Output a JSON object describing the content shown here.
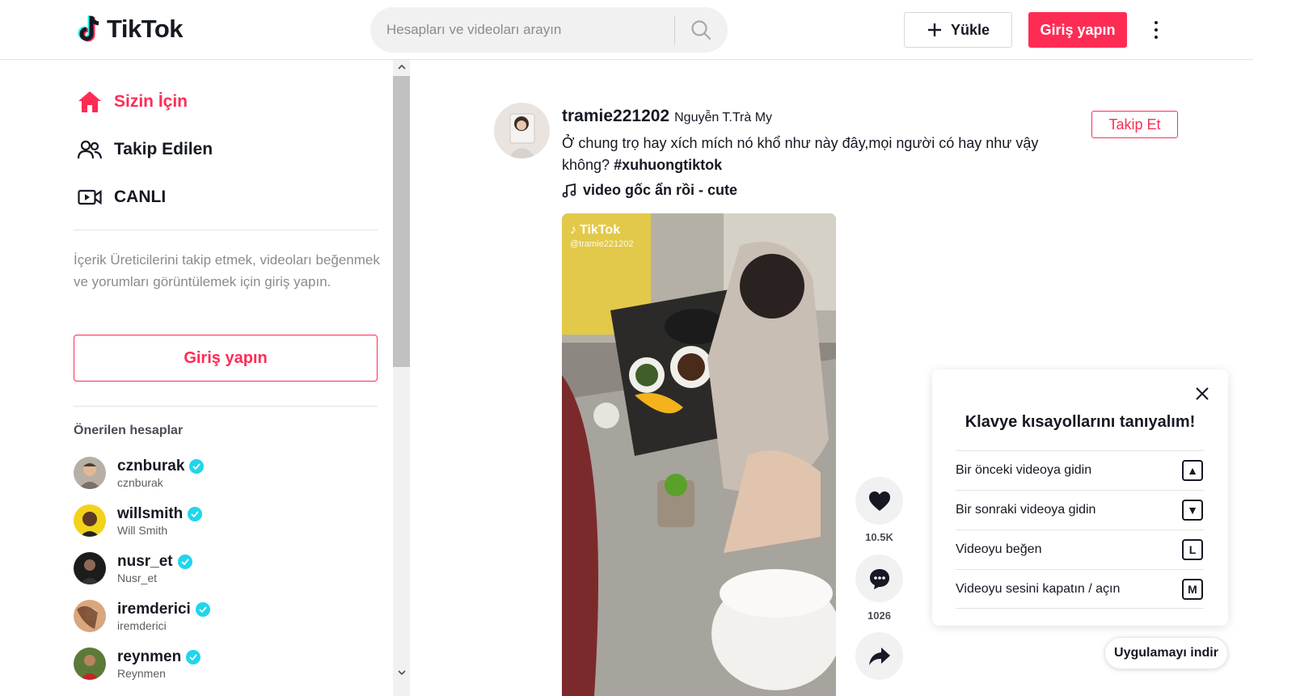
{
  "header": {
    "logo_text": "TikTok",
    "search_placeholder": "Hesapları ve videoları arayın",
    "upload_label": "Yükle",
    "login_label": "Giriş yapın"
  },
  "sidebar": {
    "nav": [
      {
        "label": "Sizin İçin",
        "icon": "home-icon",
        "active": true
      },
      {
        "label": "Takip Edilen",
        "icon": "people-icon",
        "active": false
      },
      {
        "label": "CANLI",
        "icon": "live-icon",
        "active": false
      }
    ],
    "login_prompt": "İçerik Üreticilerini takip etmek, videoları beğenmek ve yorumları görüntülemek için giriş yapın.",
    "login_button": "Giriş yapın",
    "suggested_title": "Önerilen hesaplar",
    "accounts": [
      {
        "username": "cznburak",
        "name": "cznburak",
        "verified": true
      },
      {
        "username": "willsmith",
        "name": "Will Smith",
        "verified": true
      },
      {
        "username": "nusr_et",
        "name": "Nusr_et",
        "verified": true
      },
      {
        "username": "iremderici",
        "name": "iremderici",
        "verified": true
      },
      {
        "username": "reynmen",
        "name": "Reynmen",
        "verified": true
      }
    ]
  },
  "post": {
    "username": "tramie221202",
    "nickname": "Nguyễn T.Trà My",
    "caption": "Ở chung trọ hay xích mích nó khổ như này đây,mọi người có hay như vậy không?",
    "hashtag": "#xuhuongtiktok",
    "music": "video gốc ẩn rồi - cute",
    "follow_label": "Takip Et",
    "watermark_logo": "TikTok",
    "watermark_handle": "@tramie221202",
    "likes": "10.5K",
    "comments": "1026"
  },
  "shortcuts": {
    "title": "Klavye kısayollarını tanıyalım!",
    "items": [
      {
        "label": "Bir önceki videoya gidin",
        "key": "▲"
      },
      {
        "label": "Bir sonraki videoya gidin",
        "key": "▼"
      },
      {
        "label": "Videoyu beğen",
        "key": "L"
      },
      {
        "label": "Videoyu sesini kapatın / açın",
        "key": "M"
      }
    ]
  },
  "app_download": "Uygulamayı indir",
  "colors": {
    "brand": "#fe2c55",
    "verified": "#20d5ec",
    "text": "#161823"
  }
}
